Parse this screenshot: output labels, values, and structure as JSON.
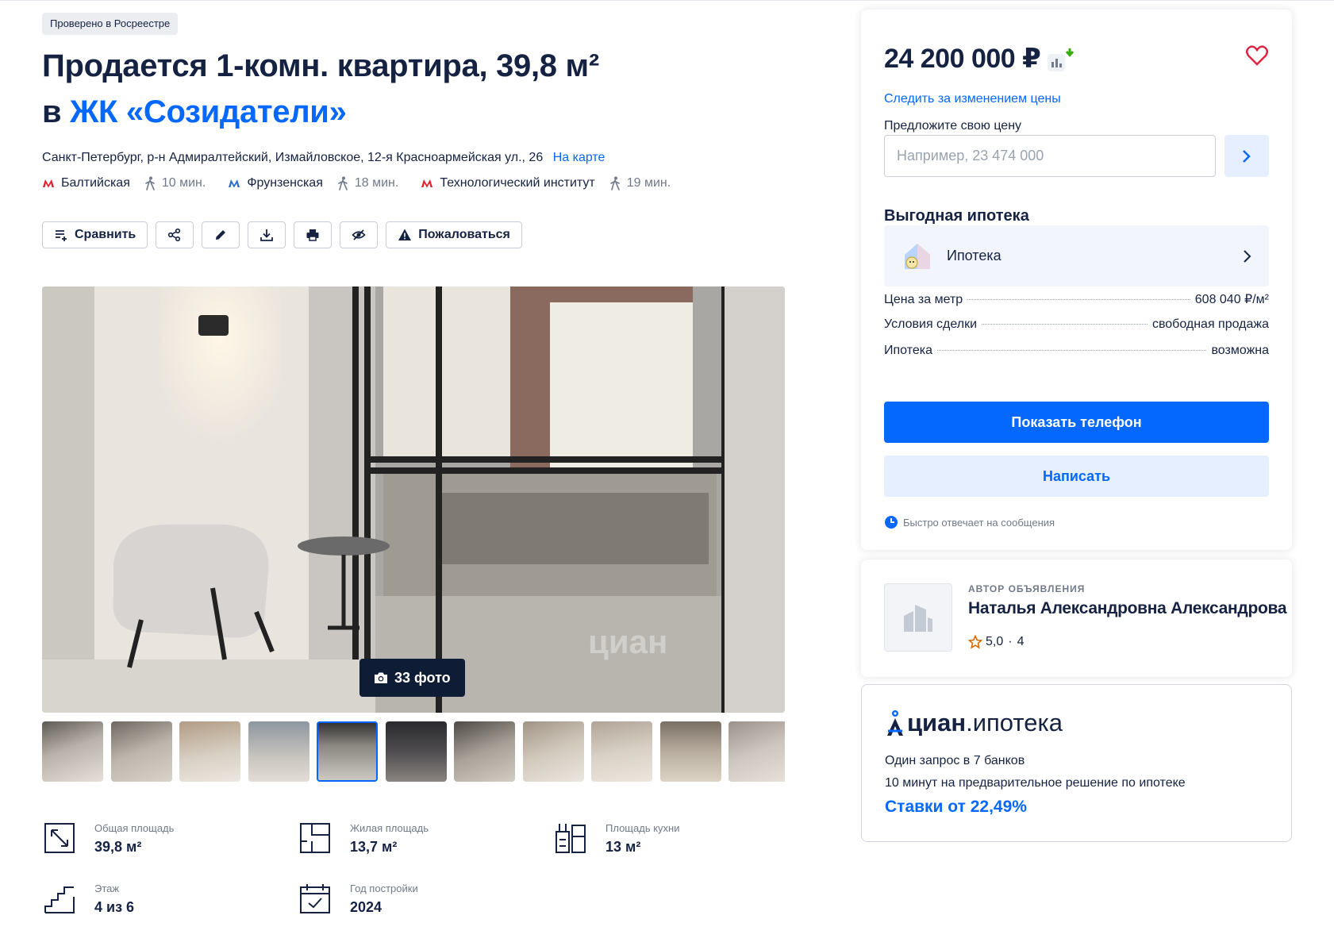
{
  "badge": "Проверено в Росреестре",
  "title": {
    "line1": "Продается 1-комн. квартира, 39,8 м²",
    "line2_prefix": "в",
    "complex_link": "ЖК «Созидатели»"
  },
  "address": {
    "text": "Санкт-Петербург, р-н Адмиралтейский, Измайловское, 12-я Красноармейская ул., 26",
    "map_link": "На карте"
  },
  "metro": [
    {
      "name": "Балтийская",
      "time": "10 мин.",
      "color": "#e4202c"
    },
    {
      "name": "Фрунзенская",
      "time": "18 мин.",
      "color": "#2d6ccf"
    },
    {
      "name": "Технологический институт",
      "time": "19 мин.",
      "color": "#e4202c"
    }
  ],
  "actions": {
    "compare": "Сравнить",
    "share_icon": "share-icon",
    "edit_icon": "pencil-icon",
    "download_icon": "download-icon",
    "print_icon": "print-icon",
    "hide_icon": "hide-icon",
    "complain": "Пожаловаться"
  },
  "gallery": {
    "photo_count": "33 фото",
    "watermark": "циан",
    "thumbnails": 11,
    "active_index": 4
  },
  "features": [
    {
      "label": "Общая площадь",
      "value": "39,8 м²",
      "icon": "area-icon"
    },
    {
      "label": "Жилая площадь",
      "value": "13,7 м²",
      "icon": "living-area-icon"
    },
    {
      "label": "Площадь кухни",
      "value": "13 м²",
      "icon": "kitchen-icon"
    },
    {
      "label": "Этаж",
      "value": "4 из 6",
      "icon": "stairs-icon"
    },
    {
      "label": "Год постройки",
      "value": "2024",
      "icon": "calendar-icon"
    }
  ],
  "sidebar": {
    "price": "24 200 000 ₽",
    "follow_price": "Следить за изменением цены",
    "offer_label": "Предложите свою цену",
    "offer_placeholder": "Например, 23 474 000",
    "mortgage_heading": "Выгодная ипотека",
    "mortgage_item": "Ипотека",
    "specs": [
      {
        "label": "Цена за метр",
        "value": "608 040 ₽/м²"
      },
      {
        "label": "Условия сделки",
        "value": "свободная продажа"
      },
      {
        "label": "Ипотека",
        "value": "возможна"
      }
    ],
    "show_phone": "Показать телефон",
    "write": "Написать",
    "fast_reply": "Быстро отвечает на сообщения"
  },
  "author": {
    "caption": "АВТОР ОБЪЯВЛЕНИЯ",
    "name": "Наталья Александровна Александрова",
    "rating": "5,0",
    "reviews": "4"
  },
  "cian_mortgage": {
    "brand": "циан",
    "product": ".ипотека",
    "line1": "Один запрос в 7 банков",
    "line2": "10 минут на предварительное решение по ипотеке",
    "rates": "Ставки от 22,49%"
  },
  "colors": {
    "accent": "#0468ff",
    "text": "#152242",
    "muted": "#707a89",
    "heart": "#e01f3d"
  }
}
